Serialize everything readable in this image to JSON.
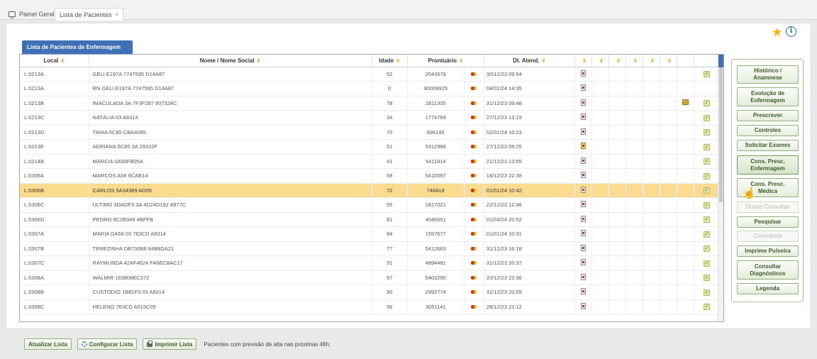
{
  "tabs": [
    {
      "label": "Painel Geral",
      "close": "×"
    },
    {
      "label": "Lista de Pacientes",
      "close": "×"
    }
  ],
  "section_title": "Lista de Pacientes de Enfermagem",
  "columns": {
    "local": "Local",
    "name": "Nome / Nome Social",
    "age": "Idade",
    "pront": "Prontuário",
    "date": "Dt. Atend."
  },
  "sort_glyph": "⇕",
  "patients": [
    {
      "local": "L:0213A",
      "name": "GELI E197A 7747595 D14A87",
      "age": "52",
      "pront": "2043578",
      "date": "30/12/23 09:54",
      "doc": "gray",
      "bed": false,
      "check": true
    },
    {
      "local": "L:0213A",
      "name": "RN GELI E197A 7747595 D14A87",
      "age": "0",
      "pront": "90009929",
      "date": "04/01/24 14:35",
      "doc": "gray",
      "bed": false,
      "check": false
    },
    {
      "local": "L:0213B",
      "name": "IMACULADA 3A 7F3F287 907324C",
      "age": "78",
      "pront": "2811305",
      "date": "31/12/23 09:48",
      "doc": "gray",
      "bed": true,
      "check": true
    },
    {
      "local": "L:0213C",
      "name": "NATÁLIA 03 A8314",
      "age": "34",
      "pront": "1774769",
      "date": "27/12/23 13:19",
      "doc": "gray",
      "bed": false,
      "check": true
    },
    {
      "local": "L:0213D",
      "name": "TANIA 5C85 CBA4085",
      "age": "70",
      "pront": "696195",
      "date": "02/01/24 10:23",
      "doc": "gray",
      "bed": false,
      "check": true
    },
    {
      "local": "L:0213E",
      "name": "ADRIANA 5C85 3A 29332F",
      "age": "51",
      "pront": "5412986",
      "date": "27/12/23 09:25",
      "doc": "orange",
      "bed": false,
      "check": true
    },
    {
      "local": "L:0214B",
      "name": "MARCIA 0A58FB05A",
      "age": "41",
      "pront": "5411814",
      "date": "21/12/23 13:55",
      "doc": "gray",
      "bed": false,
      "check": true
    },
    {
      "local": "L:0306A",
      "name": "MARCOS A58 6CAB14",
      "age": "59",
      "pront": "5410097",
      "date": "18/12/23 22:38",
      "doc": "gray",
      "bed": false,
      "check": true
    },
    {
      "local": "L:0306B",
      "name": "CARLOS 5A34389 AD05",
      "age": "72",
      "pront": "748418",
      "date": "01/01/24 10:42",
      "doc": "gray",
      "bed": false,
      "check": true
    },
    {
      "local": "L:0306C",
      "name": "ULTIMO 3DADF3 3A 4D24D192 8977C",
      "age": "55",
      "pront": "2817021",
      "date": "22/12/23 12:46",
      "doc": "gray",
      "bed": false,
      "check": true
    },
    {
      "local": "L:0306D",
      "name": "PEDRO 8C2B949 4BFFB",
      "age": "81",
      "pront": "4546651",
      "date": "01/04/24 20:52",
      "doc": "gray",
      "bed": false,
      "check": true
    },
    {
      "local": "L:0307A",
      "name": "MARIA DA59 03 763CD A8314",
      "age": "84",
      "pront": "1557677",
      "date": "01/01/24 10:31",
      "doc": "gray",
      "bed": false,
      "check": true
    },
    {
      "local": "L:0307B",
      "name": "TEREZINHA DB730B6 84B8DA21",
      "age": "77",
      "pront": "5412663",
      "date": "31/12/23 16:18",
      "doc": "gray",
      "bed": false,
      "check": true
    },
    {
      "local": "L:0307C",
      "name": "RAYMUNDA 42AF4624 FA6EC8AC17",
      "age": "91",
      "pront": "4894481",
      "date": "31/12/23 20:37",
      "doc": "gray",
      "bed": false,
      "check": true
    },
    {
      "local": "L:0308A",
      "name": "WALMIR 163808EC372",
      "age": "67",
      "pront": "5403290",
      "date": "20/12/23 22:36",
      "doc": "gray",
      "bed": false,
      "check": true
    },
    {
      "local": "L:0308B",
      "name": "CUSTODIO 1B81F3 03 A8314",
      "age": "90",
      "pront": "2992774",
      "date": "31/12/23 20:59",
      "doc": "gray",
      "bed": false,
      "check": true
    },
    {
      "local": "L:0308C",
      "name": "HELENO 763CD A015C05",
      "age": "56",
      "pront": "3051141",
      "date": "28/12/23 21:12",
      "doc": "gray",
      "bed": false,
      "check": true
    }
  ],
  "selected_index": 8,
  "side_menu": [
    {
      "label": "Histórico /\nAnamnese",
      "enabled": true
    },
    {
      "label": "Evolução de\nEnfermagem",
      "enabled": true
    },
    {
      "label": "Prescrever",
      "enabled": true
    },
    {
      "label": "Controles",
      "enabled": true
    },
    {
      "label": "Solicitar Exames",
      "enabled": true
    },
    {
      "label": "Cons. Presc.\nEnfermagem",
      "enabled": true
    },
    {
      "label": "Cons. Presc.\nMédica",
      "enabled": true
    },
    {
      "label": "Outras Consultas",
      "enabled": false
    },
    {
      "label": "Pesquisar",
      "enabled": true
    },
    {
      "label": "Consultoria",
      "enabled": false
    },
    {
      "label": "Imprime Pulseira",
      "enabled": true
    },
    {
      "label": "Consultar\nDiagnósticos",
      "enabled": true
    },
    {
      "label": "Legenda",
      "enabled": true
    }
  ],
  "bottom": {
    "refresh": "Atualizar Lista",
    "configure": "Configurar Lista",
    "print": "Imprimir Lista",
    "note": "Pacientes com previsão de alta nas próximas 48h."
  },
  "colors": {
    "selected_row": "#fbdc8e",
    "header_blue": "#3f6fb5",
    "button_green": "#3d5a2a",
    "star": "#f4b400"
  }
}
